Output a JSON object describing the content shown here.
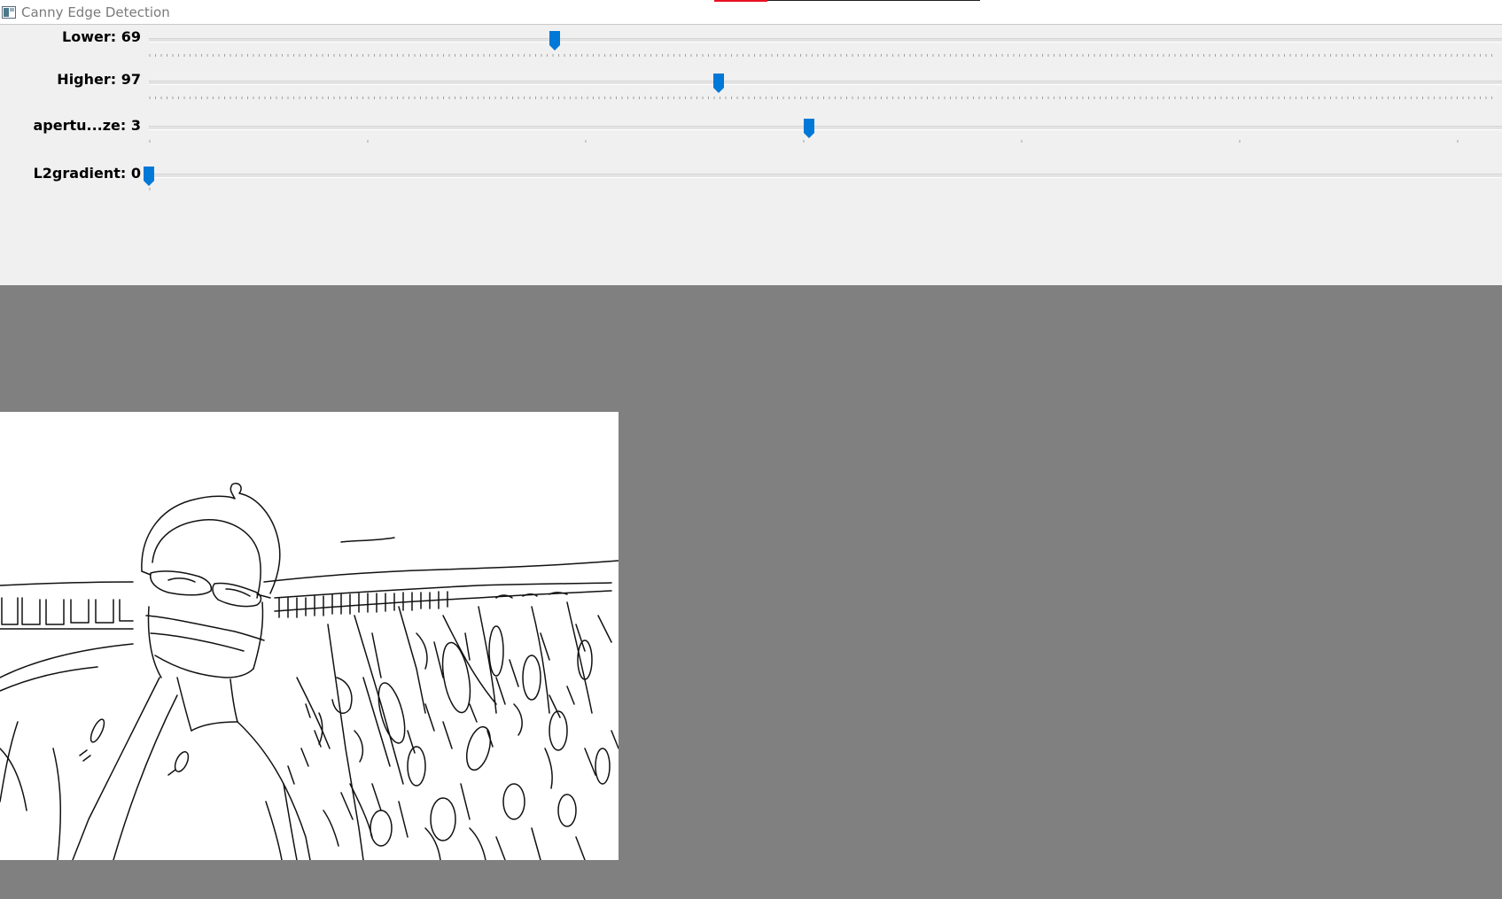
{
  "window": {
    "title": "Canny Edge Detection",
    "icon": "opencv-window-icon"
  },
  "colors": {
    "thumb": "#0078d7",
    "panel_bg": "#f0f0f0",
    "canvas_bg": "#808080",
    "accent_red": "#e81123"
  },
  "trackbars": [
    {
      "label": "Lower: 69",
      "value": 69,
      "fraction": 0.3073
    },
    {
      "label": "Higher: 97",
      "value": 97,
      "fraction": 0.4313
    },
    {
      "label": "apertu...ze: 3",
      "value": 3,
      "fraction": 0.5
    },
    {
      "label": "L2gradient: 0",
      "value": 0,
      "fraction": 0.0
    }
  ],
  "image": {
    "description_icon": "edge-image"
  }
}
